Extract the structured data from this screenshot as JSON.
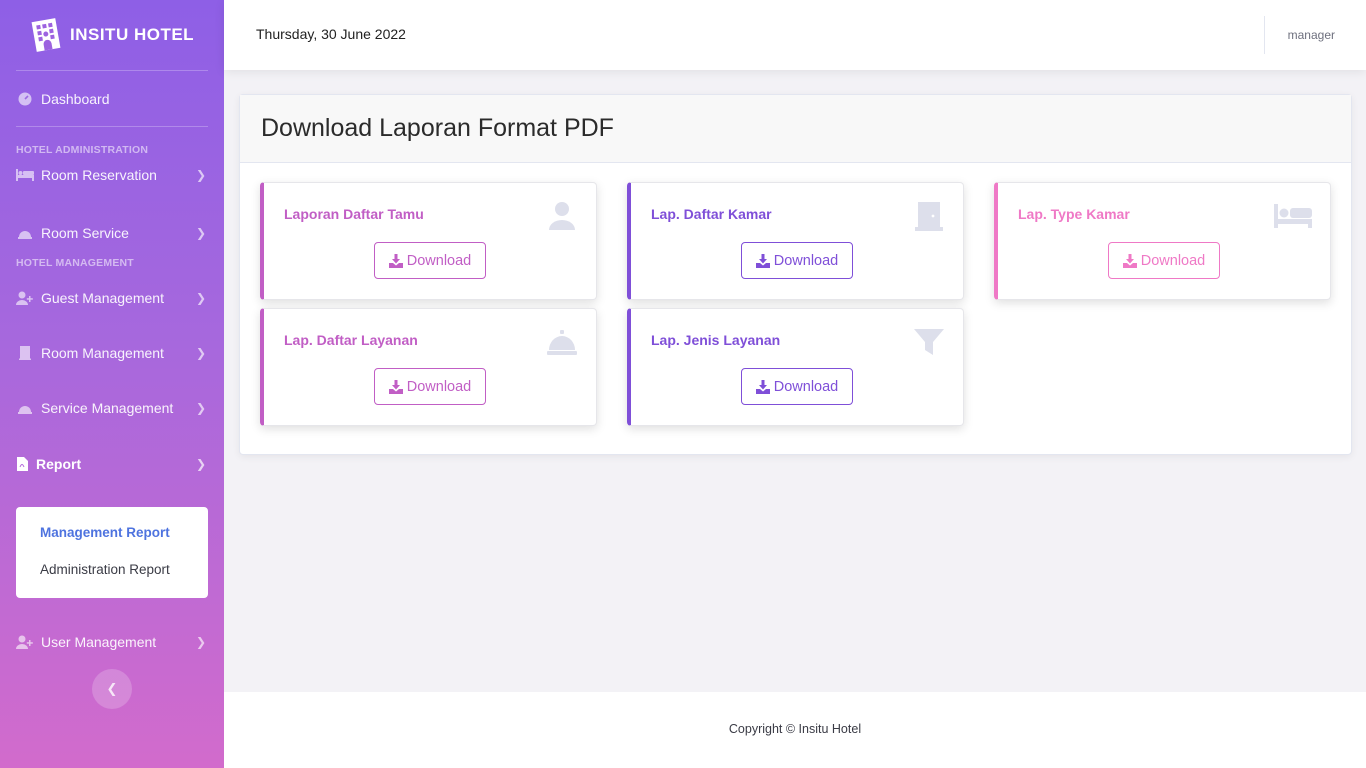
{
  "app": {
    "brand": "INSITU HOTEL"
  },
  "sidebar": {
    "dashboard": "Dashboard",
    "heading_admin": "HOTEL ADMINISTRATION",
    "room_reservation": "Room Reservation",
    "room_service": "Room Service",
    "heading_management": "HOTEL MANAGEMENT",
    "guest_management": "Guest Management",
    "room_management": "Room Management",
    "service_management": "Service Management",
    "report": "Report",
    "submenu": {
      "management_report": "Management Report",
      "administration_report": "Administration Report"
    },
    "user_management": "User Management"
  },
  "topbar": {
    "date": "Thursday, 30 June 2022",
    "user": "manager"
  },
  "page": {
    "title": "Download Laporan Format PDF"
  },
  "reports": [
    {
      "title": "Laporan Daftar Tamu",
      "button": "Download",
      "icon": "user-icon",
      "color": "#c15ec5"
    },
    {
      "title": "Lap. Daftar Kamar",
      "button": "Download",
      "icon": "door-icon",
      "color": "#7f4fd8"
    },
    {
      "title": "Lap. Type Kamar",
      "button": "Download",
      "icon": "bed-icon",
      "color": "#ef79c6"
    },
    {
      "title": "Lap. Daftar Layanan",
      "button": "Download",
      "icon": "service-bell-icon",
      "color": "#c15ec5"
    },
    {
      "title": "Lap. Jenis Layanan",
      "button": "Download",
      "icon": "filter-icon",
      "color": "#7f4fd8"
    }
  ],
  "footer": {
    "copyright": "Copyright © Insitu Hotel"
  }
}
